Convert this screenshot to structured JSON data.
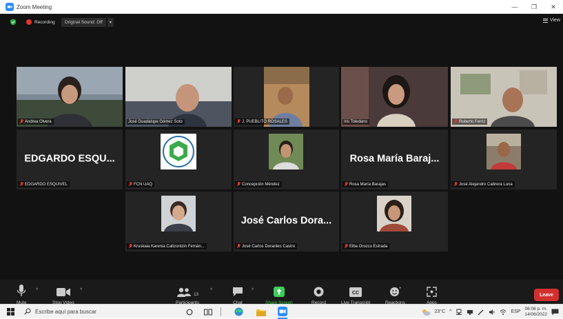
{
  "window": {
    "title": "Zoom Meeting"
  },
  "topbar": {
    "recording": "Recording",
    "original_sound": "Original Sound: Off",
    "view": "View"
  },
  "participants": [
    {
      "name": "Andrea Olvera",
      "muted": true,
      "video": true
    },
    {
      "name": "José Guadalupe Gómez Soto",
      "muted": false,
      "video": true
    },
    {
      "name": "J. PUEBLITO ROSALES",
      "muted": true,
      "video": true
    },
    {
      "name": "Iris Toledano",
      "muted": false,
      "video": true,
      "active": true
    },
    {
      "name": "Roberto Ferriz",
      "muted": true,
      "video": true
    },
    {
      "name": "EDGARDO ESQUIVEL",
      "muted": true,
      "video": false,
      "display_name": "EDGARDO ESQU..."
    },
    {
      "name": "FCN UAQ",
      "muted": true,
      "video": true
    },
    {
      "name": "Concepción Méndez",
      "muted": true,
      "video": true
    },
    {
      "name": "Rosa María Barajas",
      "muted": true,
      "video": false,
      "display_name": "Rosa María Baraj..."
    },
    {
      "name": "José Alejandro Cabrera Luna",
      "muted": true,
      "video": true
    },
    {
      "name": "Kruskaia Karenia Caltzontzin Fernán...",
      "muted": true,
      "video": true
    },
    {
      "name": "José Carlos Dorantes Castro",
      "muted": true,
      "video": false,
      "display_name": "José Carlos Dora..."
    },
    {
      "name": "Elba Orozco Estrada",
      "muted": true,
      "video": true
    }
  ],
  "toolbar": {
    "mute": "Mute",
    "stop_video": "Stop Video",
    "participants": "Participants",
    "participants_count": "13",
    "chat": "Chat",
    "share_screen": "Share Screen",
    "record": "Record",
    "live_transcript": "Live Transcript",
    "reactions": "Reactions",
    "apps": "Apps",
    "leave": "Leave"
  },
  "taskbar": {
    "search_placeholder": "Escribe aquí para buscar",
    "temperature": "23°C",
    "language": "ESP",
    "time": "06:06 p. m.",
    "date": "14/06/2022"
  },
  "colors": {
    "active_border": "#c7dc4e",
    "leave": "#d32f2f",
    "share": "#3ccd5a",
    "muted_red": "#e0362a"
  }
}
